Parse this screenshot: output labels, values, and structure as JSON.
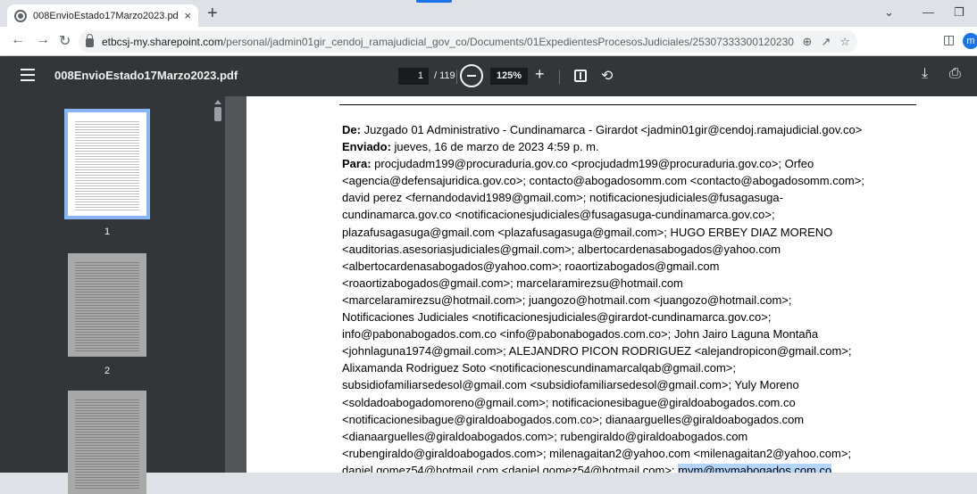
{
  "browser": {
    "tab_title": "008EnvioEstado17Marzo2023.pd",
    "tab_close": "×",
    "new_tab": "+",
    "url_host": "etbcsj-my.sharepoint.com",
    "url_path": "/personal/jadmin01gir_cendoj_ramajudicial_gov_co/Documents/01ExpedientesProcesosJudiciales/25307333300120230003000/008EnvioE...",
    "profile_initial": "m",
    "accent_color": "#1a73e8"
  },
  "pdf_toolbar": {
    "title": "008EnvioEstado17Marzo2023.pdf",
    "current_page": "1",
    "total_pages": "/ 119",
    "zoom": "125%",
    "zoom_in": "+"
  },
  "thumbnails": [
    {
      "number": "1",
      "active": true
    },
    {
      "number": "2",
      "active": false
    }
  ],
  "email": {
    "from_label": "De:",
    "from_value": " Juzgado 01 Administrativo - Cundinamarca - Girardot <jadmin01gir@cendoj.ramajudicial.gov.co>",
    "sent_label": "Enviado:",
    "sent_value": " jueves, 16 de marzo de 2023 4:59 p. m.",
    "to_label": "Para:",
    "to_first": " procjudadm199@procuraduria.gov.co <procjudadm199@procuraduria.gov.co>; Orfeo",
    "to_lines": [
      "<agencia@defensajuridica.gov.co>; contacto@abogadosomm.com <contacto@abogadosomm.com>;",
      "david perez <fernandodavid1989@gmail.com>; notificacionesjudiciales@fusagasuga-",
      "cundinamarca.gov.co <notificacionesjudiciales@fusagasuga-cundinamarca.gov.co>;",
      "plazafusagasuga@gmail.com <plazafusagasuga@gmail.com>; HUGO ERBEY DIAZ MORENO",
      "<auditorias.asesoriasjudiciales@gmail.com>; albertocardenasabogados@yahoo.com",
      "<albertocardenasabogados@yahoo.com>; roaortizabogados@gmail.com",
      "<roaortizabogados@gmail.com>; marcelaramirezsu@hotmail.com",
      "<marcelaramirezsu@hotmail.com>; juangozo@hotmail.com <juangozo@hotmail.com>;",
      "Notificaciones Judiciales <notificacionesjudiciales@girardot-cundinamarca.gov.co>;",
      "info@pabonabogados.com.co <info@pabonabogados.com.co>; John Jairo Laguna Montaña",
      "<johnlaguna1974@gmail.com>; ALEJANDRO PICON RODRIGUEZ <alejandropicon@gmail.com>;",
      "Alixamanda Rodriguez Soto <notificacionescundinamarcalqab@gmail.com>;",
      "subsidiofamiliarsedesol@gmail.com <subsidiofamiliarsedesol@gmail.com>; Yuly Moreno",
      "<soldadoabogadomoreno@gmail.com>; notificacionesibague@giraldoabogados.com.co",
      "<notificacionesibague@giraldoabogados.com.co>; dianaarguelles@giraldoabogados.com",
      "<dianaarguelles@giraldoabogados.com>; rubengiraldo@giraldoabogados.com",
      "<rubengiraldo@giraldoabogados.com>; milenagaitan2@yahoo.com <milenagaitan2@yahoo.com>;"
    ],
    "last_line": "daniel.gomez54@hotmail.com <daniel.gomez54@hotmail.com>; ",
    "last_line_selected": "mym@mymabogados.com.co"
  }
}
